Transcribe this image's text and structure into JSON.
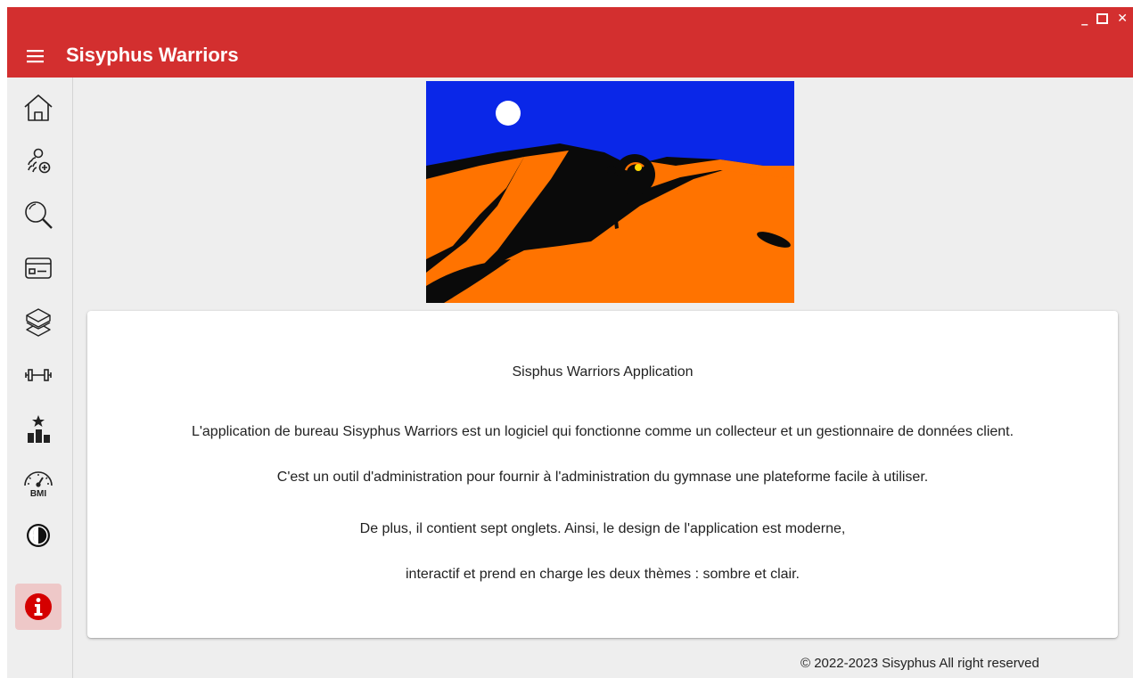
{
  "app": {
    "title": "Sisyphus Warriors"
  },
  "window_controls": {
    "minimize": "_",
    "close": "✕"
  },
  "sidebar": {
    "items": [
      {
        "id": "home",
        "icon": "home-icon"
      },
      {
        "id": "add-members",
        "icon": "add-members-icon"
      },
      {
        "id": "search",
        "icon": "search-icon"
      },
      {
        "id": "membership-card",
        "icon": "membership-card-icon"
      },
      {
        "id": "boxes",
        "icon": "boxes-icon"
      },
      {
        "id": "exercises",
        "icon": "dumbbell-icon"
      },
      {
        "id": "ranking",
        "icon": "ranking-icon"
      },
      {
        "id": "bmi",
        "icon": "bmi-gauge-icon",
        "label": "BMI"
      },
      {
        "id": "theme",
        "icon": "theme-toggle-icon"
      },
      {
        "id": "about",
        "icon": "info-icon",
        "active": true
      }
    ]
  },
  "colors": {
    "accent": "#d32f2f",
    "active_item_bg": "#eec8c8",
    "sky": "#0a27e8",
    "sand": "#ff7300",
    "shadow": "#0a0a0a"
  },
  "about": {
    "heading": "Sisphus Warriors Application",
    "paragraphs": [
      "L'application de bureau Sisyphus Warriors est un logiciel qui fonctionne comme un collecteur et un gestionnaire de données client.",
      "C'est un outil d'administration pour fournir à l'administration du gymnase une plateforme facile à utiliser.",
      "De plus, il contient sept onglets. Ainsi, le design de l'application est moderne,",
      "interactif et prend en charge les deux thèmes : sombre et clair."
    ]
  },
  "footer": {
    "copyright": "© 2022-2023 Sisyphus All right reserved"
  }
}
